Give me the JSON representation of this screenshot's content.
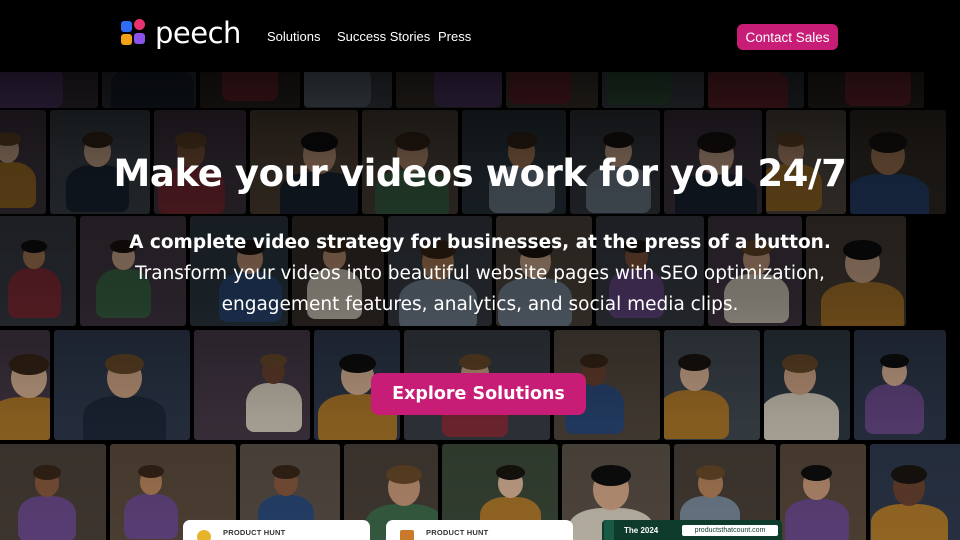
{
  "nav": {
    "logo_text": "peech",
    "links": [
      "Solutions",
      "Success Stories",
      "Press"
    ],
    "contact_label": "Contact Sales"
  },
  "hero": {
    "title": "Make your videos work for you 24/7",
    "subtitle_bold": "A complete video strategy for businesses, at the press of a button.",
    "subtitle_lines": [
      "Transform your videos into beautiful website pages with SEO optimization,",
      "engagement features, analytics, and social media clips."
    ],
    "cta_label": "Explore Solutions"
  },
  "badges": [
    {
      "label": "PRODUCT HUNT",
      "icon": "product-hunt-medal-icon",
      "color": "#e8b52a"
    },
    {
      "label": "PRODUCT HUNT",
      "icon": "product-hunt-award-icon",
      "color": "#c8792a"
    }
  ],
  "award": {
    "year_text": "The 2024",
    "site_text": "productsthatcount.com"
  },
  "colors": {
    "accent": "#c81d77",
    "nav_bg": "#000000"
  }
}
